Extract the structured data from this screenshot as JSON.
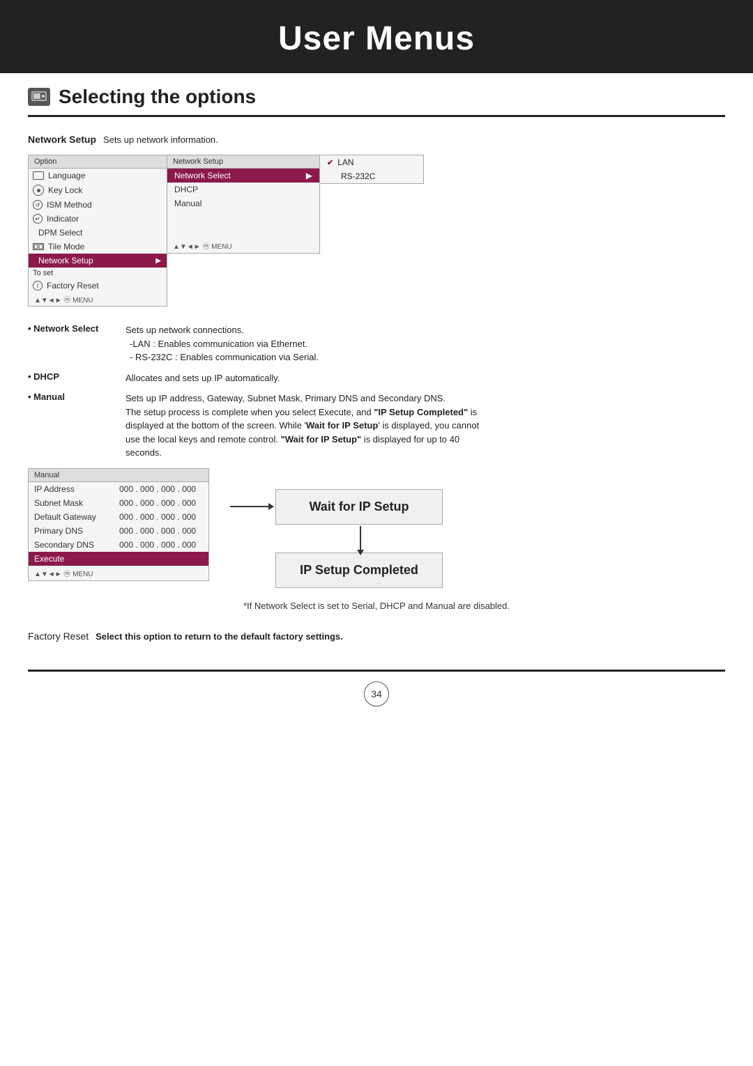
{
  "header": {
    "title": "User Menus"
  },
  "section": {
    "heading": "Selecting the options"
  },
  "networkSetup": {
    "label": "Network Setup",
    "description": "Sets up network information.",
    "menu1": {
      "header": "Option",
      "items": [
        {
          "label": "Language",
          "icon": "monitor"
        },
        {
          "label": "Key Lock",
          "icon": "circle-dot"
        },
        {
          "label": "ISM Method",
          "icon": "circle-arrow"
        },
        {
          "label": "Indicator",
          "icon": "circle-arrow2"
        },
        {
          "label": "DPM Select",
          "icon": "none"
        },
        {
          "label": "Tile Mode",
          "icon": "flat"
        },
        {
          "label": "Network Setup",
          "highlighted": true,
          "hasArrow": true
        },
        {
          "label": "Factory Reset",
          "icon": "info"
        },
        {
          "label": "To set",
          "isLabel": true
        }
      ],
      "footer": "▲▼◄► ⓜ MENU"
    },
    "menu2": {
      "header": "Network Setup",
      "items": [
        {
          "label": "Network Select",
          "highlighted": true,
          "hasArrow": true
        },
        {
          "label": "DHCP"
        },
        {
          "label": "Manual"
        }
      ],
      "footer": "▲▼◄► ⓜ MENU"
    },
    "menu3": {
      "items": [
        {
          "label": "LAN",
          "checked": true
        },
        {
          "label": "RS-232C"
        }
      ]
    }
  },
  "bullets": {
    "networkSelect": {
      "label": "• Network Select",
      "desc": "Sets up network connections.",
      "sub1": "-LAN : Enables communication via Ethernet.",
      "sub2": "- RS-232C : Enables communication via Serial."
    },
    "dhcp": {
      "label": "• DHCP",
      "desc": "Allocates and sets up IP automatically."
    },
    "manual": {
      "label": "• Manual",
      "desc1": "Sets up IP address, Gateway, Subnet Mask, Primary DNS and Secondary DNS.",
      "desc2": "The setup process is complete when you select Execute, and",
      "bold1": "\"IP Setup Completed\"",
      "desc3": "is displayed at the bottom of the screen. While '",
      "bold2": "Wait for IP Setup",
      "desc4": "' is displayed, you cannot use the local keys and remote control.",
      "bold3": "\"Wait for IP Setup\"",
      "desc5": "is displayed for up to 40 seconds."
    }
  },
  "manualMenu": {
    "header": "Manual",
    "fields": [
      {
        "label": "IP Address",
        "value": "000 . 000 . 000 . 000"
      },
      {
        "label": "Subnet Mask",
        "value": "000 . 000 . 000 . 000"
      },
      {
        "label": "Default Gateway",
        "value": "000 . 000 . 000 . 000"
      },
      {
        "label": "Primary DNS",
        "value": "000 . 000 . 000 . 000"
      },
      {
        "label": "Secondary DNS",
        "value": "000 . 000 . 000 . 000"
      },
      {
        "label": "Execute",
        "highlighted": true
      }
    ],
    "footer": "▲▼◄► ⓜ MENU"
  },
  "flow": {
    "box1": "Wait for IP  Setup",
    "box2": "IP Setup Completed"
  },
  "footerNote": "*If Network Select is set to Serial, DHCP and Manual are disabled.",
  "factoryReset": {
    "label": "Factory Reset",
    "desc": "Select this option to return to the default factory settings."
  },
  "pageNumber": "34"
}
